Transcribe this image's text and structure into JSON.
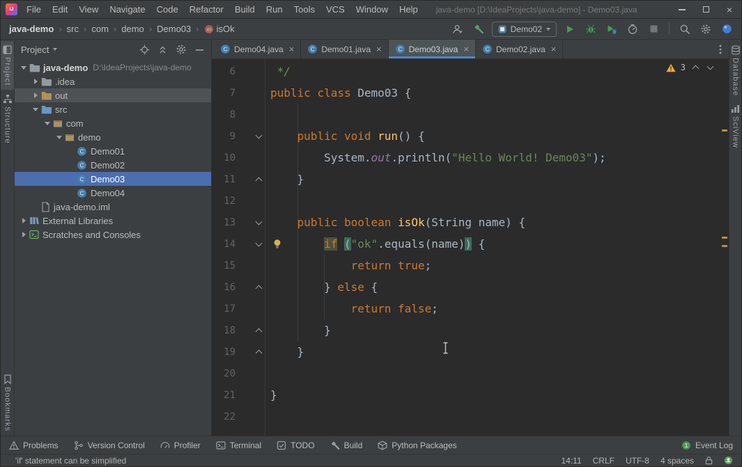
{
  "title_bar": {
    "menus": [
      "File",
      "Edit",
      "View",
      "Navigate",
      "Code",
      "Refactor",
      "Build",
      "Run",
      "Tools",
      "VCS",
      "Window",
      "Help"
    ],
    "title": "java-demo [D:\\IdeaProjects\\java-demo] - Demo03.java"
  },
  "nav_bar": {
    "breadcrumbs": [
      {
        "label": "java-demo",
        "root": true
      },
      {
        "label": "src"
      },
      {
        "label": "com"
      },
      {
        "label": "demo"
      },
      {
        "label": "Demo03"
      },
      {
        "label": "isOk",
        "icon": "method"
      }
    ],
    "run_config_label": "Demo02",
    "right_items": [
      {
        "icon": "user"
      },
      {
        "icon": "build-hammer"
      },
      {
        "type": "run-config"
      },
      {
        "icon": "run"
      },
      {
        "icon": "debug"
      },
      {
        "icon": "coverage"
      },
      {
        "icon": "profiler-run"
      },
      {
        "icon": "stop"
      },
      {
        "type": "sep"
      },
      {
        "icon": "search"
      },
      {
        "icon": "settings"
      },
      {
        "icon": "code-with-me"
      }
    ]
  },
  "left_stripe": {
    "top": [
      {
        "label": "Project",
        "icon": "project",
        "active": true
      },
      {
        "label": "Structure",
        "icon": "structure",
        "active": false
      }
    ],
    "bottom": [
      {
        "label": "Bookmarks",
        "icon": "bookmarks",
        "active": false
      }
    ]
  },
  "right_stripe": {
    "top": [
      {
        "label": "Database",
        "icon": "database"
      },
      {
        "label": "SciView",
        "icon": "sciview"
      }
    ]
  },
  "project_panel": {
    "title": "Project",
    "header_icons": [
      "locate",
      "collapse-all",
      "settings",
      "hide"
    ],
    "tree": [
      {
        "label": "java-demo",
        "hint": "D:\\IdeaProjects\\java-demo",
        "icon": "folder",
        "chevron": "open",
        "indent": 0,
        "root": true
      },
      {
        "label": ".idea",
        "icon": "folder",
        "chevron": "closed",
        "indent": 1
      },
      {
        "label": "out",
        "icon": "folder-out",
        "chevron": "closed",
        "indent": 1,
        "selected": "inactive"
      },
      {
        "label": "src",
        "icon": "folder-src",
        "chevron": "open",
        "indent": 1
      },
      {
        "label": "com",
        "icon": "package",
        "chevron": "open",
        "indent": 2
      },
      {
        "label": "demo",
        "icon": "package",
        "chevron": "open",
        "indent": 3
      },
      {
        "label": "Demo01",
        "icon": "class",
        "indent": 4
      },
      {
        "label": "Demo02",
        "icon": "class",
        "indent": 4
      },
      {
        "label": "Demo03",
        "icon": "class",
        "indent": 4,
        "selected": "active"
      },
      {
        "label": "Demo04",
        "icon": "class",
        "indent": 4
      },
      {
        "label": "java-demo.iml",
        "icon": "iml-file",
        "indent": 1
      },
      {
        "label": "External Libraries",
        "icon": "library",
        "chevron": "closed",
        "indent": 0
      },
      {
        "label": "Scratches and Consoles",
        "icon": "console",
        "chevron": "closed",
        "indent": 0
      }
    ]
  },
  "editor": {
    "tabs": [
      {
        "label": "Demo04.java",
        "icon": "class",
        "active": false
      },
      {
        "label": "Demo01.java",
        "icon": "class",
        "active": false
      },
      {
        "label": "Demo03.java",
        "icon": "class",
        "active": true
      },
      {
        "label": "Demo02.java",
        "icon": "class",
        "active": false
      }
    ],
    "warning_count": "3",
    "code_lines": [
      {
        "n": 6,
        "tokens": [
          {
            "t": " */",
            "c": "cmt"
          }
        ]
      },
      {
        "n": 7,
        "tokens": [
          {
            "t": "public",
            "c": "kw"
          },
          {
            "t": " "
          },
          {
            "t": "class",
            "c": "kw"
          },
          {
            "t": " Demo03 {"
          }
        ]
      },
      {
        "n": 8,
        "tokens": []
      },
      {
        "n": 9,
        "fold": "open",
        "tokens": [
          {
            "t": "    "
          },
          {
            "t": "public",
            "c": "kw"
          },
          {
            "t": " "
          },
          {
            "t": "void",
            "c": "kw"
          },
          {
            "t": " "
          },
          {
            "t": "run",
            "c": "mth"
          },
          {
            "t": "() {"
          }
        ]
      },
      {
        "n": 10,
        "tokens": [
          {
            "t": "        System."
          },
          {
            "t": "out",
            "c": "fld"
          },
          {
            "t": ".println("
          },
          {
            "t": "\"Hello World! Demo03\"",
            "c": "str"
          },
          {
            "t": ");"
          }
        ]
      },
      {
        "n": 11,
        "fold": "close",
        "tokens": [
          {
            "t": "    }"
          }
        ]
      },
      {
        "n": 12,
        "tokens": []
      },
      {
        "n": 13,
        "fold": "open",
        "tokens": [
          {
            "t": "    "
          },
          {
            "t": "public",
            "c": "kw"
          },
          {
            "t": " "
          },
          {
            "t": "boolean",
            "c": "kw"
          },
          {
            "t": " "
          },
          {
            "t": "isOk",
            "c": "mth"
          },
          {
            "t": "(String name) {"
          }
        ]
      },
      {
        "n": 14,
        "fold": "open",
        "bulb": true,
        "tokens": [
          {
            "t": "        "
          },
          {
            "t": "if",
            "c": "kw hl-warn"
          },
          {
            "t": " "
          },
          {
            "t": "(",
            "c": "hl-brace"
          },
          {
            "t": "\"ok\"",
            "c": "str"
          },
          {
            "t": ".equals(name)"
          },
          {
            "t": ")",
            "c": "hl-brace"
          },
          {
            "t": " {"
          }
        ]
      },
      {
        "n": 15,
        "tokens": [
          {
            "t": "            "
          },
          {
            "t": "return",
            "c": "kw"
          },
          {
            "t": " "
          },
          {
            "t": "true",
            "c": "kw"
          },
          {
            "t": ";"
          }
        ]
      },
      {
        "n": 16,
        "fold": "close",
        "tokens": [
          {
            "t": "        } "
          },
          {
            "t": "else",
            "c": "kw"
          },
          {
            "t": " {"
          }
        ]
      },
      {
        "n": 17,
        "tokens": [
          {
            "t": "            "
          },
          {
            "t": "return",
            "c": "kw"
          },
          {
            "t": " "
          },
          {
            "t": "false",
            "c": "kw"
          },
          {
            "t": ";"
          }
        ]
      },
      {
        "n": 18,
        "fold": "close",
        "tokens": [
          {
            "t": "        }"
          }
        ]
      },
      {
        "n": 19,
        "fold": "close",
        "tokens": [
          {
            "t": "    }"
          }
        ]
      },
      {
        "n": 20,
        "tokens": []
      },
      {
        "n": 21,
        "tokens": [
          {
            "t": "}"
          }
        ]
      },
      {
        "n": 22,
        "tokens": []
      }
    ]
  },
  "bottom_bar": {
    "left": [
      {
        "label": "Problems",
        "icon": "problems"
      },
      {
        "label": "Version Control",
        "icon": "vcs"
      },
      {
        "label": "Profiler",
        "icon": "gauge"
      },
      {
        "label": "Terminal",
        "icon": "terminal"
      },
      {
        "label": "TODO",
        "icon": "todo"
      },
      {
        "label": "Build",
        "icon": "build"
      },
      {
        "label": "Python Packages",
        "icon": "python"
      }
    ],
    "right": [
      {
        "label": "Event Log",
        "icon": "event"
      }
    ]
  },
  "status_bar": {
    "message": "'if' statement can be simplified",
    "items": [
      "14:11",
      "CRLF",
      "UTF-8",
      "4 spaces"
    ]
  }
}
